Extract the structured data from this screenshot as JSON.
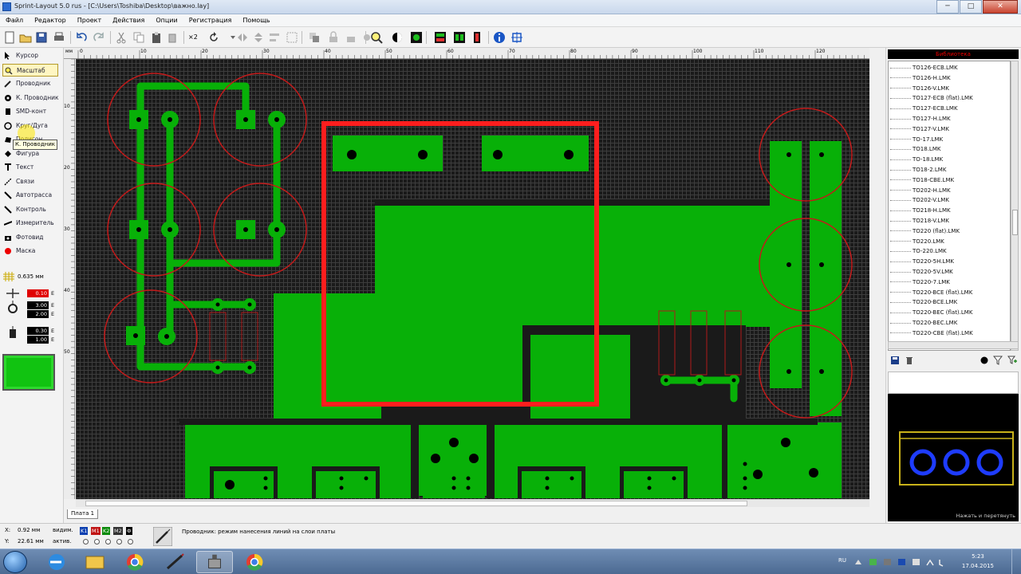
{
  "window": {
    "title": "Sprint-Layout 5.0 rus - [C:\\Users\\Toshiba\\Desktop\\важно.lay]",
    "min_label": "─",
    "max_label": "□",
    "close_label": "✕"
  },
  "menu": {
    "items": [
      "Файл",
      "Редактор",
      "Проект",
      "Действия",
      "Опции",
      "Регистрация",
      "Помощь"
    ]
  },
  "toolbar": {
    "zoom_label": "×2"
  },
  "tools": {
    "items": [
      {
        "label": "Курсор",
        "icon": "arrow-icon"
      },
      {
        "label": "Масштаб",
        "icon": "zoom-icon"
      },
      {
        "label": "Проводник",
        "icon": "pencil-icon"
      },
      {
        "label": "К. Проводник",
        "icon": "pad-icon"
      },
      {
        "label": "SMD-конт",
        "icon": "smd-icon"
      },
      {
        "label": "Круг/Дуга",
        "icon": "circle-icon"
      },
      {
        "label": "Полигон",
        "icon": "polygon-icon"
      },
      {
        "label": "Фигура",
        "icon": "shape-icon"
      },
      {
        "label": "Текст",
        "icon": "text-icon"
      },
      {
        "label": "Связи",
        "icon": "link-icon"
      },
      {
        "label": "Автотрасса",
        "icon": "autoroute-icon"
      },
      {
        "label": "Контроль",
        "icon": "check-icon"
      },
      {
        "label": "Измеритель",
        "icon": "ruler-icon"
      },
      {
        "label": "Фотовид",
        "icon": "camera-icon"
      },
      {
        "label": "Маска",
        "icon": "mask-icon"
      }
    ],
    "tooltip": "К. Проводник",
    "grid_value": "0.635 мм",
    "fields": [
      {
        "value": "0.10",
        "unit": "E",
        "color": "#e00000"
      },
      {
        "value": "3.00",
        "unit": "E",
        "color": "#000000"
      },
      {
        "value": "2.00",
        "unit": "E",
        "color": "#000000"
      },
      {
        "value": "0.30",
        "unit": "E",
        "color": "#000000"
      },
      {
        "value": "1.00",
        "unit": "E",
        "color": "#000000"
      }
    ]
  },
  "rulers": {
    "top_prefix": "мм",
    "top": [
      "0",
      "10",
      "20",
      "30",
      "40",
      "50",
      "60",
      "70",
      "80",
      "90",
      "100",
      "110",
      "120"
    ],
    "left": [
      "0",
      "10",
      "20",
      "30",
      "40",
      "50"
    ]
  },
  "board_tab": "Плата 1",
  "library": {
    "header": "Библиотека",
    "items": [
      "TO126-ECB.LMK",
      "TO126-H.LMK",
      "TO126-V.LMK",
      "TO127-ECB (flat).LMK",
      "TO127-ECB.LMK",
      "TO127-H.LMK",
      "TO127-V.LMK",
      "TO-17.LMK",
      "TO18.LMK",
      "TO-18.LMK",
      "TO18-2.LMK",
      "TO18-CBE.LMK",
      "TO202-H.LMK",
      "TO202-V.LMK",
      "TO218-H.LMK",
      "TO218-V.LMK",
      "TO220 (flat).LMK",
      "TO220.LMK",
      "TO-220.LMK",
      "TO220-5H.LMK",
      "TO220-5V.LMK",
      "TO220-7.LMK",
      "TO220-BCE (flat).LMK",
      "TO220-BCE.LMK",
      "TO220-BEC (flat).LMK",
      "TO220-BEC.LMK",
      "TO220-CBE (flat).LMK"
    ],
    "preview_caption": "Нажать и перетянуть"
  },
  "status": {
    "x_label": "X:",
    "x_value": "0.92 мм",
    "y_label": "Y:",
    "y_value": "22.61 мм",
    "visible_label": "видим.",
    "active_label": "актив.",
    "layers": [
      "K1",
      "M1",
      "K2",
      "M2",
      "Ф"
    ],
    "message": "Проводник: режим нанесения линий на слои платы"
  },
  "taskbar": {
    "lang": "RU",
    "time": "5:23",
    "date": "17.04.2015"
  },
  "colors": {
    "copper": "#08b008",
    "board_bg": "#1a1a1a",
    "highlight": "#ff1e1e",
    "circle": "#c41a1a"
  }
}
